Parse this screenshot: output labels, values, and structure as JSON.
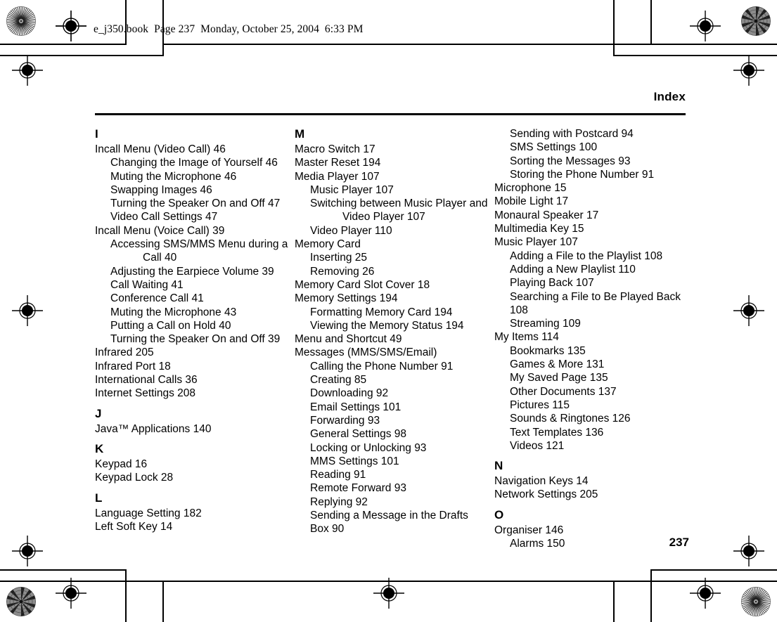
{
  "page": {
    "book_header": "e_j350.book  Page 237  Monday, October 25, 2004  6:33 PM",
    "running_head": "Index",
    "folio": "237",
    "ink_color": "#000000",
    "paper_color": "#ffffff"
  },
  "marks": {
    "registration_icon": "registration-target-icon",
    "star_icon": "star-target-icon",
    "crop_icon": "crop-mark-icon"
  },
  "index": {
    "columns": [
      {
        "groups": [
          {
            "letter": "I",
            "entries": [
              {
                "text": "Incall Menu (Video Call) 46",
                "level": 0,
                "wrap": false
              },
              {
                "text": "Changing the Image of Yourself 46",
                "level": 1,
                "wrap": false
              },
              {
                "text": "Muting the Microphone 46",
                "level": 1,
                "wrap": false
              },
              {
                "text": "Swapping Images 46",
                "level": 1,
                "wrap": false
              },
              {
                "text": "Turning the Speaker On and Off 47",
                "level": 1,
                "wrap": false
              },
              {
                "text": "Video Call Settings 47",
                "level": 1,
                "wrap": false
              },
              {
                "text": "Incall Menu (Voice Call) 39",
                "level": 0,
                "wrap": false
              },
              {
                "text": "Accessing SMS/MMS Menu during a Call 40",
                "level": 1,
                "wrap": true
              },
              {
                "text": "Adjusting the Earpiece Volume 39",
                "level": 1,
                "wrap": false
              },
              {
                "text": "Call Waiting 41",
                "level": 1,
                "wrap": false
              },
              {
                "text": "Conference Call 41",
                "level": 1,
                "wrap": false
              },
              {
                "text": "Muting the Microphone 43",
                "level": 1,
                "wrap": false
              },
              {
                "text": "Putting a Call on Hold 40",
                "level": 1,
                "wrap": false
              },
              {
                "text": "Turning the Speaker On and Off 39",
                "level": 1,
                "wrap": false
              },
              {
                "text": "Infrared 205",
                "level": 0,
                "wrap": false
              },
              {
                "text": "Infrared Port 18",
                "level": 0,
                "wrap": false
              },
              {
                "text": "International Calls 36",
                "level": 0,
                "wrap": false
              },
              {
                "text": "Internet Settings 208",
                "level": 0,
                "wrap": false
              }
            ]
          },
          {
            "letter": "J",
            "entries": [
              {
                "text": "Java™ Applications 140",
                "level": 0,
                "wrap": false
              }
            ]
          },
          {
            "letter": "K",
            "entries": [
              {
                "text": "Keypad 16",
                "level": 0,
                "wrap": false
              },
              {
                "text": "Keypad Lock 28",
                "level": 0,
                "wrap": false
              }
            ]
          },
          {
            "letter": "L",
            "entries": [
              {
                "text": "Language Setting 182",
                "level": 0,
                "wrap": false
              },
              {
                "text": "Left Soft Key 14",
                "level": 0,
                "wrap": false
              }
            ]
          }
        ]
      },
      {
        "groups": [
          {
            "letter": "M",
            "entries": [
              {
                "text": "Macro Switch 17",
                "level": 0,
                "wrap": false
              },
              {
                "text": "Master Reset 194",
                "level": 0,
                "wrap": false
              },
              {
                "text": "Media Player 107",
                "level": 0,
                "wrap": false
              },
              {
                "text": "Music Player 107",
                "level": 1,
                "wrap": false
              },
              {
                "text": "Switching between Music Player and Video Player 107",
                "level": 1,
                "wrap": true
              },
              {
                "text": "Video Player 110",
                "level": 1,
                "wrap": false
              },
              {
                "text": "Memory Card",
                "level": 0,
                "wrap": false
              },
              {
                "text": "Inserting 25",
                "level": 1,
                "wrap": false
              },
              {
                "text": "Removing 26",
                "level": 1,
                "wrap": false
              },
              {
                "text": "Memory Card Slot Cover 18",
                "level": 0,
                "wrap": false
              },
              {
                "text": "Memory Settings 194",
                "level": 0,
                "wrap": false
              },
              {
                "text": "Formatting Memory Card 194",
                "level": 1,
                "wrap": false
              },
              {
                "text": "Viewing the Memory Status 194",
                "level": 1,
                "wrap": false
              },
              {
                "text": "Menu and Shortcut 49",
                "level": 0,
                "wrap": false
              },
              {
                "text": "Messages (MMS/SMS/Email)",
                "level": 0,
                "wrap": false
              },
              {
                "text": "Calling the Phone Number 91",
                "level": 1,
                "wrap": false
              },
              {
                "text": "Creating 85",
                "level": 1,
                "wrap": false
              },
              {
                "text": "Downloading 92",
                "level": 1,
                "wrap": false
              },
              {
                "text": "Email Settings 101",
                "level": 1,
                "wrap": false
              },
              {
                "text": "Forwarding 93",
                "level": 1,
                "wrap": false
              },
              {
                "text": "General Settings 98",
                "level": 1,
                "wrap": false
              },
              {
                "text": "Locking or Unlocking 93",
                "level": 1,
                "wrap": false
              },
              {
                "text": "MMS Settings 101",
                "level": 1,
                "wrap": false
              },
              {
                "text": "Reading 91",
                "level": 1,
                "wrap": false
              },
              {
                "text": "Remote Forward 93",
                "level": 1,
                "wrap": false
              },
              {
                "text": "Replying 92",
                "level": 1,
                "wrap": false
              },
              {
                "text": "Sending a Message in the Drafts Box 90",
                "level": 1,
                "wrap": false
              }
            ]
          }
        ]
      },
      {
        "groups": [
          {
            "letter": "",
            "entries": [
              {
                "text": "Sending with Postcard 94",
                "level": 1,
                "wrap": false
              },
              {
                "text": "SMS Settings 100",
                "level": 1,
                "wrap": false
              },
              {
                "text": "Sorting the Messages 93",
                "level": 1,
                "wrap": false
              },
              {
                "text": "Storing the Phone Number 91",
                "level": 1,
                "wrap": false
              },
              {
                "text": "Microphone 15",
                "level": 0,
                "wrap": false
              },
              {
                "text": "Mobile Light 17",
                "level": 0,
                "wrap": false
              },
              {
                "text": "Monaural Speaker 17",
                "level": 0,
                "wrap": false
              },
              {
                "text": "Multimedia Key 15",
                "level": 0,
                "wrap": false
              },
              {
                "text": "Music Player 107",
                "level": 0,
                "wrap": false
              },
              {
                "text": "Adding a File to the Playlist 108",
                "level": 1,
                "wrap": false
              },
              {
                "text": "Adding a New Playlist 110",
                "level": 1,
                "wrap": false
              },
              {
                "text": "Playing Back 107",
                "level": 1,
                "wrap": false
              },
              {
                "text": "Searching a File to Be Played Back 108",
                "level": 1,
                "wrap": false
              },
              {
                "text": "Streaming 109",
                "level": 1,
                "wrap": false
              },
              {
                "text": "My Items 114",
                "level": 0,
                "wrap": false
              },
              {
                "text": "Bookmarks 135",
                "level": 1,
                "wrap": false
              },
              {
                "text": "Games & More 131",
                "level": 1,
                "wrap": false
              },
              {
                "text": "My Saved Page 135",
                "level": 1,
                "wrap": false
              },
              {
                "text": "Other Documents 137",
                "level": 1,
                "wrap": false
              },
              {
                "text": "Pictures 115",
                "level": 1,
                "wrap": false
              },
              {
                "text": "Sounds & Ringtones 126",
                "level": 1,
                "wrap": false
              },
              {
                "text": "Text Templates 136",
                "level": 1,
                "wrap": false
              },
              {
                "text": "Videos 121",
                "level": 1,
                "wrap": false
              }
            ]
          },
          {
            "letter": "N",
            "entries": [
              {
                "text": "Navigation Keys 14",
                "level": 0,
                "wrap": false
              },
              {
                "text": "Network Settings 205",
                "level": 0,
                "wrap": false
              }
            ]
          },
          {
            "letter": "O",
            "entries": [
              {
                "text": "Organiser 146",
                "level": 0,
                "wrap": false
              },
              {
                "text": "Alarms 150",
                "level": 1,
                "wrap": false
              }
            ]
          }
        ]
      }
    ]
  }
}
